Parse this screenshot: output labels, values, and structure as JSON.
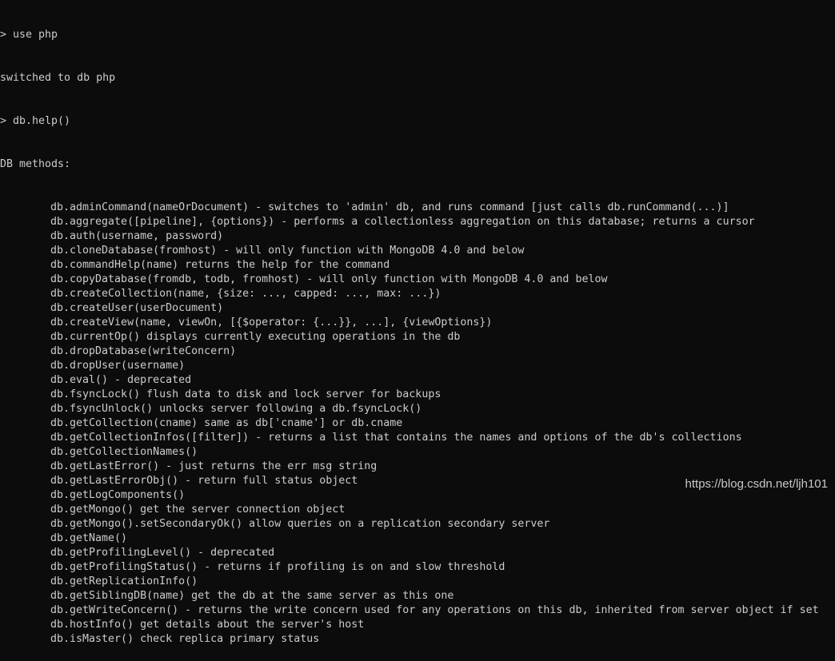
{
  "terminal": {
    "lines": [
      "> use php",
      "switched to db php",
      "> db.help()",
      "DB methods:"
    ],
    "methods": [
      "db.adminCommand(nameOrDocument) - switches to 'admin' db, and runs command [just calls db.runCommand(...)]",
      "db.aggregate([pipeline], {options}) - performs a collectionless aggregation on this database; returns a cursor",
      "db.auth(username, password)",
      "db.cloneDatabase(fromhost) - will only function with MongoDB 4.0 and below",
      "db.commandHelp(name) returns the help for the command",
      "db.copyDatabase(fromdb, todb, fromhost) - will only function with MongoDB 4.0 and below",
      "db.createCollection(name, {size: ..., capped: ..., max: ...})",
      "db.createUser(userDocument)",
      "db.createView(name, viewOn, [{$operator: {...}}, ...], {viewOptions})",
      "db.currentOp() displays currently executing operations in the db",
      "db.dropDatabase(writeConcern)",
      "db.dropUser(username)",
      "db.eval() - deprecated",
      "db.fsyncLock() flush data to disk and lock server for backups",
      "db.fsyncUnlock() unlocks server following a db.fsyncLock()",
      "db.getCollection(cname) same as db['cname'] or db.cname",
      "db.getCollectionInfos([filter]) - returns a list that contains the names and options of the db's collections",
      "db.getCollectionNames()",
      "db.getLastError() - just returns the err msg string",
      "db.getLastErrorObj() - return full status object",
      "db.getLogComponents()",
      "db.getMongo() get the server connection object",
      "db.getMongo().setSecondaryOk() allow queries on a replication secondary server",
      "db.getName()",
      "db.getProfilingLevel() - deprecated",
      "db.getProfilingStatus() - returns if profiling is on and slow threshold",
      "db.getReplicationInfo()",
      "db.getSiblingDB(name) get the db at the same server as this one",
      "db.getWriteConcern() - returns the write concern used for any operations on this db, inherited from server object if set",
      "db.hostInfo() get details about the server's host",
      "db.isMaster() check replica primary status"
    ]
  },
  "watermark": "https://blog.csdn.net/ljh101",
  "colors": {
    "background": "#0c0c0c",
    "text": "#cccccc"
  }
}
